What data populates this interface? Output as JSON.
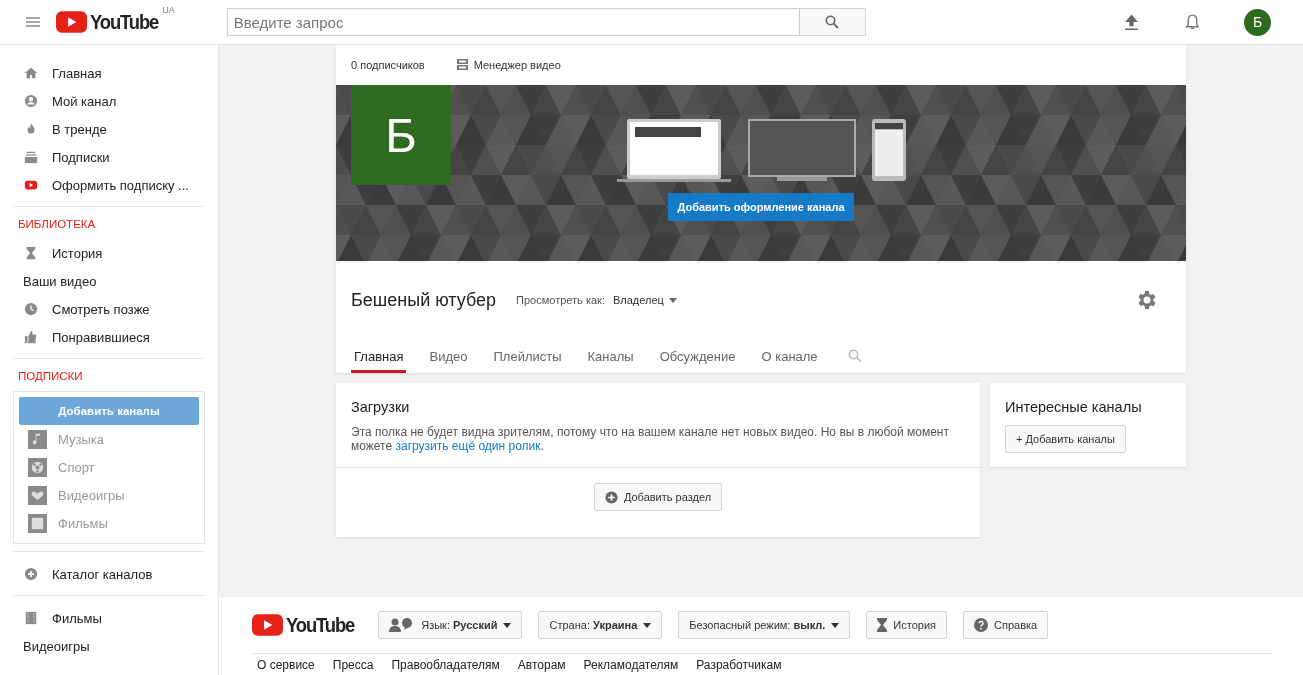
{
  "header": {
    "logo_text": "YouTube",
    "region": "UA",
    "search": {
      "placeholder": "Введите запрос"
    },
    "avatar_letter": "Б"
  },
  "sidebar": {
    "sections": [
      {
        "items": [
          {
            "label": "Главная",
            "kind": "home"
          },
          {
            "label": "Мой канал",
            "kind": "account"
          },
          {
            "label": "В тренде",
            "kind": "flame"
          },
          {
            "label": "Подписки",
            "kind": "subs"
          },
          {
            "label": "Оформить подписку ...",
            "kind": "red"
          }
        ]
      },
      {
        "heading": "БИБЛИОТЕКА",
        "items": [
          {
            "label": "История",
            "kind": "hourglass"
          },
          {
            "label": "Ваши видео",
            "kind": "none"
          },
          {
            "label": "Смотреть позже",
            "kind": "clock"
          },
          {
            "label": "Понравившиеся",
            "kind": "thumb"
          }
        ]
      },
      {
        "heading": "ПОДПИСКИ",
        "add_button": "Добавить каналы",
        "channels": [
          {
            "label": "Музыка",
            "kind": "music"
          },
          {
            "label": "Спорт",
            "kind": "ball"
          },
          {
            "label": "Видеоигры",
            "kind": "heart"
          },
          {
            "label": "Фильмы",
            "kind": "film"
          }
        ]
      },
      {
        "items": [
          {
            "label": "Каталог каналов",
            "kind": "plus"
          }
        ]
      },
      {
        "items": [
          {
            "label": "Фильмы",
            "kind": "filmstrip"
          },
          {
            "label": "Видеоигры",
            "kind": "none"
          }
        ]
      }
    ]
  },
  "channel": {
    "subscribers": "0 подписчиков",
    "video_manager": "Менеджер видео",
    "avatar_letter": "Б",
    "banner_button": "Добавить оформление канала",
    "name": "Бешеный ютубер",
    "view_as_label": "Просмотреть как:",
    "view_as_value": "Владелец",
    "tabs": [
      {
        "label": "Главная",
        "selected": true
      },
      {
        "label": "Видео",
        "selected": false
      },
      {
        "label": "Плейлисты",
        "selected": false
      },
      {
        "label": "Каналы",
        "selected": false
      },
      {
        "label": "Обсуждение",
        "selected": false
      },
      {
        "label": "О канале",
        "selected": false
      }
    ]
  },
  "uploads": {
    "title": "Загрузки",
    "text": "Эта полка не будет видна зрителям, потому что на вашем канале нет новых видео. Но вы в любой момент можете ",
    "link": "загрузить ещё один ролик",
    "text_end": ".",
    "add_section": "Добавить раздел"
  },
  "featured": {
    "title": "Интересные каналы",
    "button": "+ Добавить каналы"
  },
  "footer": {
    "logo_text": "YouTube",
    "buttons": [
      {
        "kind": "language",
        "label": "Язык:",
        "value": "Русский"
      },
      {
        "kind": "country",
        "label": "Страна:",
        "value": "Украина"
      },
      {
        "kind": "safe",
        "label": "Безопасный режим:",
        "value": "выкл."
      },
      {
        "kind": "history",
        "label": "История"
      },
      {
        "kind": "help",
        "label": "Справка"
      }
    ],
    "links": [
      "О сервисе",
      "Пресса",
      "Правообладателям",
      "Авторам",
      "Рекламодателям",
      "Разработчикам"
    ]
  }
}
